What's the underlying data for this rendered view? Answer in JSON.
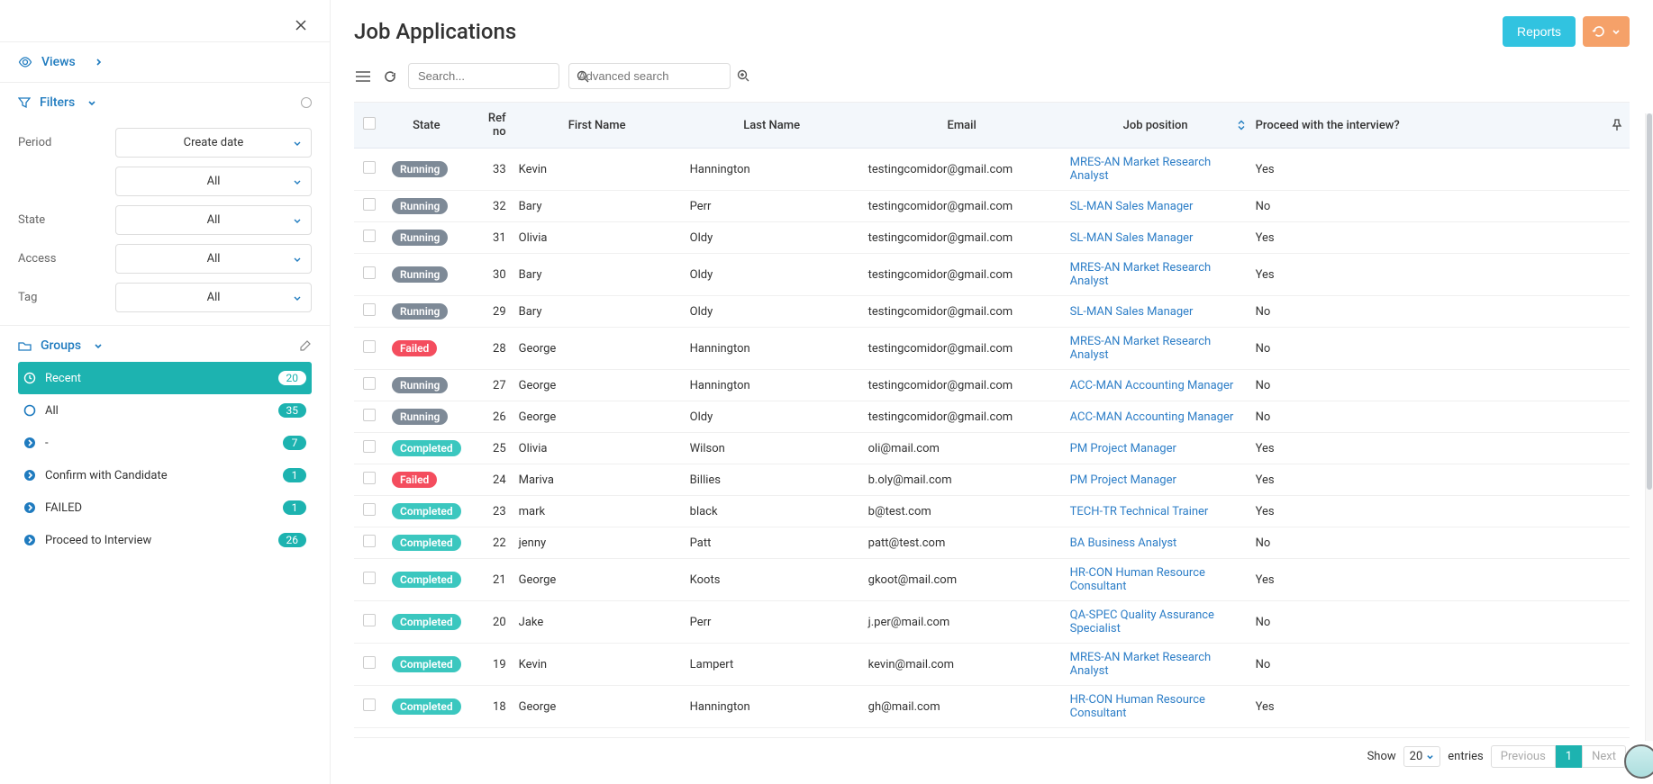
{
  "sidebar": {
    "views_label": "Views",
    "filters_label": "Filters",
    "groups_label": "Groups",
    "filters": {
      "period_label": "Period",
      "period_select1": "Create date",
      "period_select2": "All",
      "state_label": "State",
      "state_select": "All",
      "access_label": "Access",
      "access_select": "All",
      "tag_label": "Tag",
      "tag_select": "All"
    },
    "groups": [
      {
        "name": "Recent",
        "count": "20",
        "active": true,
        "icon": "clock"
      },
      {
        "name": "All",
        "count": "35",
        "active": false,
        "icon": "circle"
      },
      {
        "name": "-",
        "count": "7",
        "active": false,
        "icon": "arrow"
      },
      {
        "name": "Confirm with Candidate",
        "count": "1",
        "active": false,
        "icon": "arrow"
      },
      {
        "name": "FAILED",
        "count": "1",
        "active": false,
        "icon": "arrow"
      },
      {
        "name": "Proceed to Interview",
        "count": "26",
        "active": false,
        "icon": "arrow"
      }
    ]
  },
  "header": {
    "title": "Job Applications",
    "reports_btn": "Reports",
    "search_placeholder": "Search...",
    "advanced_placeholder": "Advanced search"
  },
  "table": {
    "columns": {
      "state": "State",
      "ref": "Ref no",
      "first": "First Name",
      "last": "Last Name",
      "email": "Email",
      "job": "Job position",
      "proceed": "Proceed with the interview?"
    },
    "rows": [
      {
        "state": "Running",
        "ref": "33",
        "first": "Kevin",
        "last": "Hannington",
        "email": "testingcomidor@gmail.com",
        "job": "MRES-AN Market Research Analyst",
        "proceed": "Yes"
      },
      {
        "state": "Running",
        "ref": "32",
        "first": "Bary",
        "last": "Perr",
        "email": "testingcomidor@gmail.com",
        "job": "SL-MAN Sales Manager",
        "proceed": "No"
      },
      {
        "state": "Running",
        "ref": "31",
        "first": "Olivia",
        "last": "Oldy",
        "email": "testingcomidor@gmail.com",
        "job": "SL-MAN Sales Manager",
        "proceed": "Yes"
      },
      {
        "state": "Running",
        "ref": "30",
        "first": "Bary",
        "last": "Oldy",
        "email": "testingcomidor@gmail.com",
        "job": "MRES-AN Market Research Analyst",
        "proceed": "Yes"
      },
      {
        "state": "Running",
        "ref": "29",
        "first": "Bary",
        "last": "Oldy",
        "email": "testingcomidor@gmail.com",
        "job": "SL-MAN Sales Manager",
        "proceed": "No"
      },
      {
        "state": "Failed",
        "ref": "28",
        "first": "George",
        "last": "Hannington",
        "email": "testingcomidor@gmail.com",
        "job": "MRES-AN Market Research Analyst",
        "proceed": "No"
      },
      {
        "state": "Running",
        "ref": "27",
        "first": "George",
        "last": "Hannington",
        "email": "testingcomidor@gmail.com",
        "job": "ACC-MAN Accounting Manager",
        "proceed": "No"
      },
      {
        "state": "Running",
        "ref": "26",
        "first": "George",
        "last": "Oldy",
        "email": "testingcomidor@gmail.com",
        "job": "ACC-MAN Accounting Manager",
        "proceed": "No"
      },
      {
        "state": "Completed",
        "ref": "25",
        "first": "Olivia",
        "last": "Wilson",
        "email": "oli@mail.com",
        "job": "PM Project Manager",
        "proceed": "Yes"
      },
      {
        "state": "Failed",
        "ref": "24",
        "first": "Mariva",
        "last": "Billies",
        "email": "b.oly@mail.com",
        "job": "PM Project Manager",
        "proceed": "Yes"
      },
      {
        "state": "Completed",
        "ref": "23",
        "first": "mark",
        "last": "black",
        "email": "b@test.com",
        "job": "TECH-TR Technical Trainer",
        "proceed": "Yes"
      },
      {
        "state": "Completed",
        "ref": "22",
        "first": "jenny",
        "last": "Patt",
        "email": "patt@test.com",
        "job": "BA Business Analyst",
        "proceed": "No"
      },
      {
        "state": "Completed",
        "ref": "21",
        "first": "George",
        "last": "Koots",
        "email": "gkoot@mail.com",
        "job": "HR-CON Human Resource Consultant",
        "proceed": "Yes"
      },
      {
        "state": "Completed",
        "ref": "20",
        "first": "Jake",
        "last": "Perr",
        "email": "j.per@mail.com",
        "job": "QA-SPEC Quality Assurance Specialist",
        "proceed": "No"
      },
      {
        "state": "Completed",
        "ref": "19",
        "first": "Kevin",
        "last": "Lampert",
        "email": "kevin@mail.com",
        "job": "MRES-AN Market Research Analyst",
        "proceed": "No"
      },
      {
        "state": "Completed",
        "ref": "18",
        "first": "George",
        "last": "Hannington",
        "email": "gh@mail.com",
        "job": "HR-CON Human Resource Consultant",
        "proceed": "Yes"
      }
    ]
  },
  "footer": {
    "show": "Show",
    "count": "20",
    "entries": "entries",
    "prev": "Previous",
    "page": "1",
    "next": "Next"
  }
}
